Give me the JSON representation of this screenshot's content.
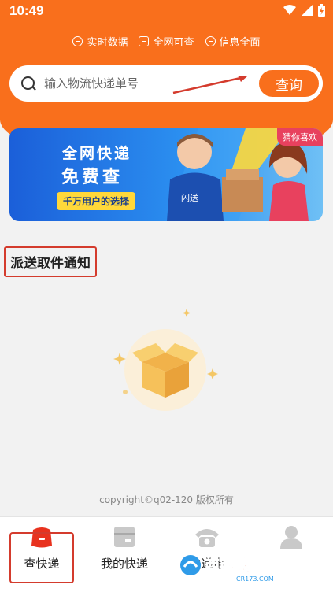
{
  "status": {
    "time": "10:49"
  },
  "features": [
    {
      "label": "实时数据",
      "icon": "clock-icon"
    },
    {
      "label": "全网可查",
      "icon": "search-doc-icon"
    },
    {
      "label": "信息全面",
      "icon": "info-icon"
    }
  ],
  "search": {
    "placeholder": "输入物流快递单号",
    "button": "查询"
  },
  "banner": {
    "tag": "猜你喜欢",
    "line1": "全网快递",
    "line2": "免费查",
    "sub": "千万用户的选择",
    "brand": "闪送"
  },
  "section": {
    "title": "派送取件通知"
  },
  "empty": {
    "icon": "empty-box-icon"
  },
  "footer": {
    "copyright": "copyright©q02-120 版权所有"
  },
  "tabs": [
    {
      "label": "查快递",
      "icon": "package-search-icon",
      "active": true
    },
    {
      "label": "我的快递",
      "icon": "my-package-icon",
      "active": false
    },
    {
      "label": "快递电",
      "icon": "phone-icon",
      "active": false
    },
    {
      "label": "",
      "icon": "user-icon",
      "active": false
    }
  ],
  "watermark": {
    "text": "西西软件园",
    "sub": "CR173.COM"
  },
  "colors": {
    "accent": "#f96f1c",
    "annotation": "#d43b2d",
    "banner": "#2b8ff0"
  }
}
